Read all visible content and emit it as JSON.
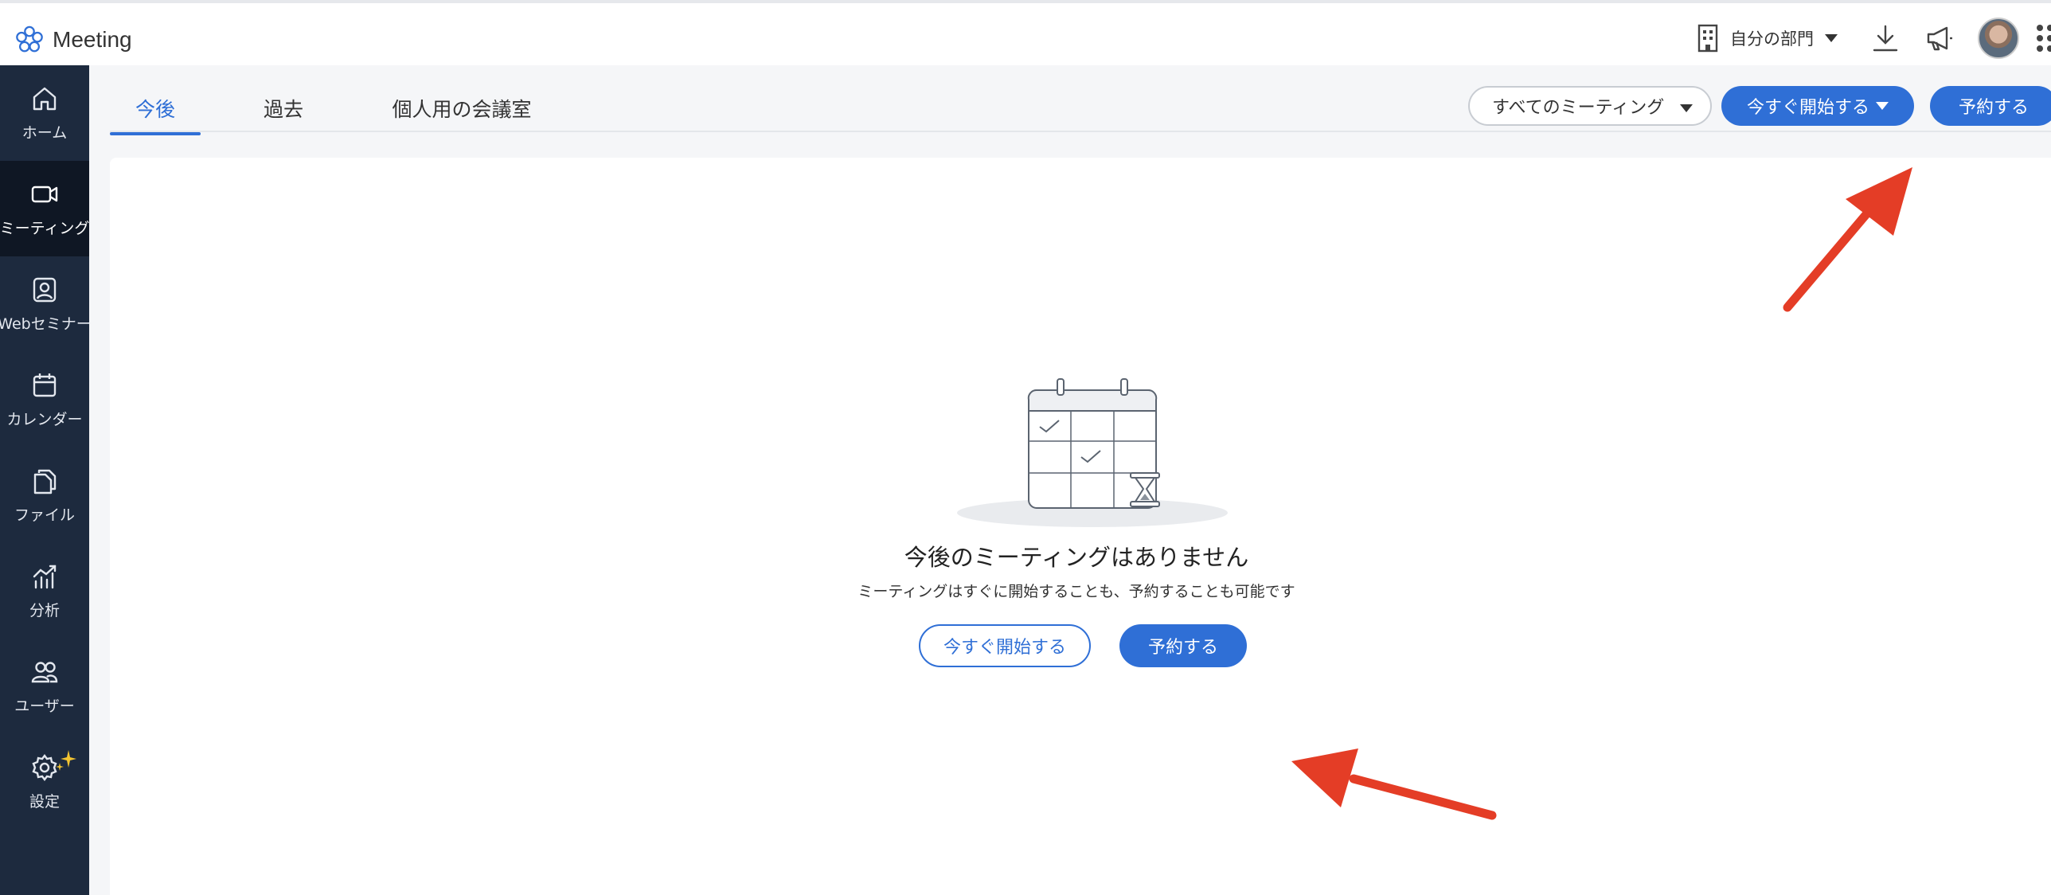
{
  "app": {
    "name": "Meeting"
  },
  "topbar": {
    "department_label": "自分の部門",
    "icons": [
      "building-icon",
      "download-icon",
      "megaphone-icon",
      "avatar",
      "apps-grid-icon"
    ]
  },
  "sidebar": {
    "items": [
      {
        "label": "ホーム",
        "icon": "home-icon",
        "active": false
      },
      {
        "label": "ミーティング",
        "icon": "video-icon",
        "active": true
      },
      {
        "label": "Webセミナー",
        "icon": "webinar-icon",
        "active": false
      },
      {
        "label": "カレンダー",
        "icon": "calendar-icon",
        "active": false
      },
      {
        "label": "ファイル",
        "icon": "files-icon",
        "active": false
      },
      {
        "label": "分析",
        "icon": "analytics-icon",
        "active": false
      },
      {
        "label": "ユーザー",
        "icon": "users-icon",
        "active": false
      },
      {
        "label": "設定",
        "icon": "gear-icon",
        "active": false,
        "badge": "sparkle-icon"
      }
    ]
  },
  "tabs": [
    {
      "label": "今後",
      "active": true
    },
    {
      "label": "過去",
      "active": false
    },
    {
      "label": "個人用の会議室",
      "active": false
    }
  ],
  "toolbar": {
    "filter_value": "すべてのミーティング",
    "start_now_label": "今すぐ開始する",
    "schedule_label": "予約する"
  },
  "empty_state": {
    "title": "今後のミーティングはありません",
    "subtitle": "ミーティングはすぐに開始することも、予約することも可能です",
    "start_button": "今すぐ開始する",
    "schedule_button": "予約する"
  },
  "colors": {
    "accent": "#2f6fd6",
    "sidebar_bg": "#1d2a3e",
    "sidebar_active_bg": "#0f1724",
    "annotation_arrow": "#e43d26"
  }
}
